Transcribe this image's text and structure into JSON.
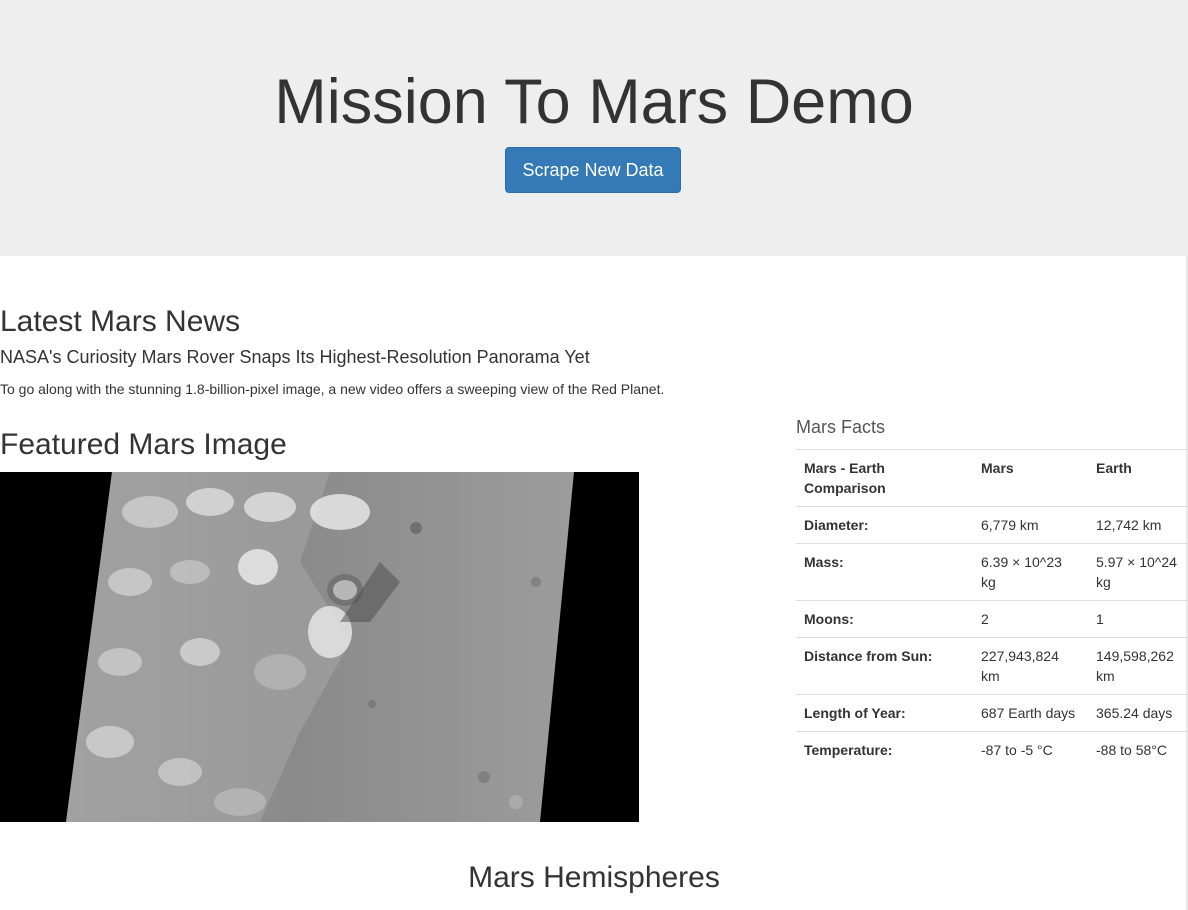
{
  "header": {
    "title": "Mission To Mars Demo",
    "scrape_label": "Scrape New Data"
  },
  "news": {
    "heading": "Latest Mars News",
    "title": "NASA's Curiosity Mars Rover Snaps Its Highest-Resolution Panorama Yet",
    "teaser": "To go along with the stunning 1.8-billion-pixel image, a new video offers a sweeping view of the Red Planet."
  },
  "featured": {
    "heading": "Featured Mars Image"
  },
  "facts": {
    "caption": "Mars Facts",
    "headers": [
      "Mars - Earth Comparison",
      "Mars",
      "Earth"
    ],
    "rows": [
      [
        "Diameter:",
        "6,779 km",
        "12,742 km"
      ],
      [
        "Mass:",
        "6.39 × 10^23 kg",
        "5.97 × 10^24 kg"
      ],
      [
        "Moons:",
        "2",
        "1"
      ],
      [
        "Distance from Sun:",
        "227,943,824 km",
        "149,598,262 km"
      ],
      [
        "Length of Year:",
        "687 Earth days",
        "365.24 days"
      ],
      [
        "Temperature:",
        "-87 to -5 °C",
        "-88 to 58°C"
      ]
    ]
  },
  "hemispheres": {
    "heading": "Mars Hemispheres"
  }
}
